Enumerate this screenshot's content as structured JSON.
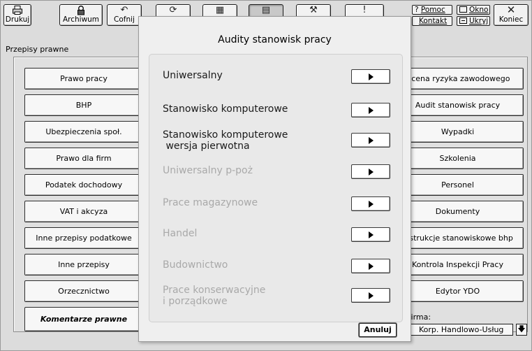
{
  "toolbar": {
    "print": "Drukuj",
    "archive": "Archiwum",
    "undo": "Cofnij",
    "help": "Pomoc",
    "contact": "Kontakt",
    "window": "Okno",
    "hide": "Ukryj",
    "close_glyph": "✕",
    "close": "Koniec",
    "exclam": "!"
  },
  "section": "Przepisy prawne",
  "left_nav": [
    "Prawo pracy",
    "BHP",
    "Ubezpieczenia społ.",
    "Prawo dla firm",
    "Podatek dochodowy",
    "VAT i akcyza",
    "Inne przepisy podatkowe",
    "Inne przepisy",
    "Orzecznictwo",
    "Komentarze prawne"
  ],
  "right_nav": [
    "Ocena ryzyka zawodowego",
    "Audit stanowisk pracy",
    "Wypadki",
    "Szkolenia",
    "Personel",
    "Dokumenty",
    "Instrukcje stanowiskowe bhp",
    "Kontrola Inspekcji Pracy",
    "Edytor YDO"
  ],
  "firma": {
    "label": "Firma:",
    "value": "Korp. Handlowo-Usług"
  },
  "modal": {
    "title": "Audity stanowisk pracy",
    "items": [
      {
        "line1": "Uniwersalny",
        "line2": "",
        "enabled": true
      },
      {
        "line1": "Stanowisko komputerowe",
        "line2": "",
        "enabled": true
      },
      {
        "line1": "Stanowisko komputerowe",
        "line2": " wersja pierwotna",
        "enabled": true
      },
      {
        "line1": "Uniwersalny p-poż",
        "line2": "",
        "enabled": false
      },
      {
        "line1": "Prace magazynowe",
        "line2": "",
        "enabled": false
      },
      {
        "line1": "Handel",
        "line2": "",
        "enabled": false
      },
      {
        "line1": "Budownictwo",
        "line2": "",
        "enabled": false
      },
      {
        "line1": "Prace konserwacyjne",
        "line2": "i porządkowe",
        "enabled": false
      }
    ],
    "cancel": "Anuluj"
  }
}
